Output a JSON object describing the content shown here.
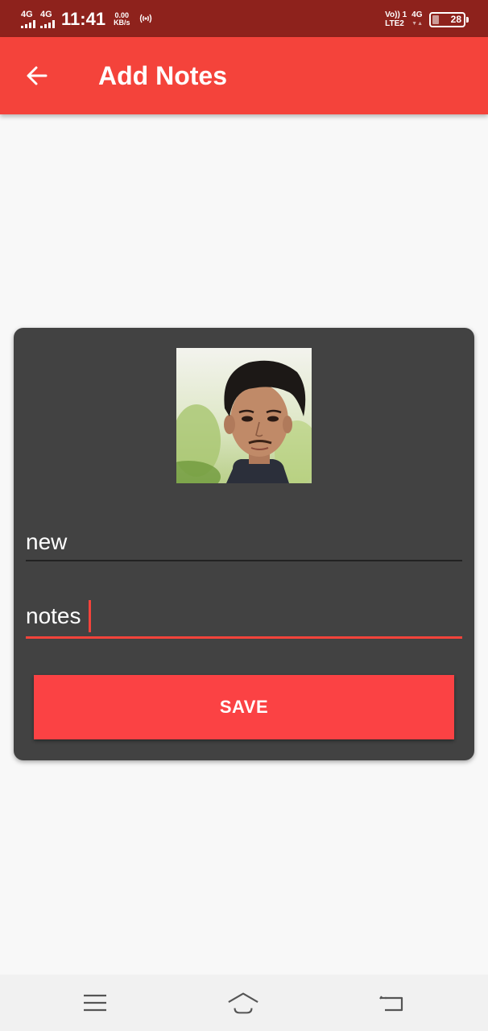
{
  "status_bar": {
    "sim1_label": "4G",
    "sim2_label": "4G",
    "time": "11:41",
    "speed_value": "0.00",
    "speed_unit": "KB/s",
    "volte_top": "Vo)) 1",
    "volte_bottom": "LTE2",
    "net_label": "4G",
    "battery": "28"
  },
  "app_bar": {
    "title": "Add Notes",
    "back_icon": "arrow-left-icon"
  },
  "form": {
    "photo_alt": "profile photo",
    "title_value": "new",
    "body_value": "notes",
    "save_label": "SAVE"
  },
  "nav_bar": {
    "menu_icon": "menu-icon",
    "home_icon": "home-icon",
    "back_icon": "back-icon"
  },
  "colors": {
    "status_bar": "#8e221c",
    "app_bar": "#f4433b",
    "card": "#424242",
    "accent": "#f4433b",
    "save_button": "#fb4244",
    "background": "#f8f8f8"
  }
}
